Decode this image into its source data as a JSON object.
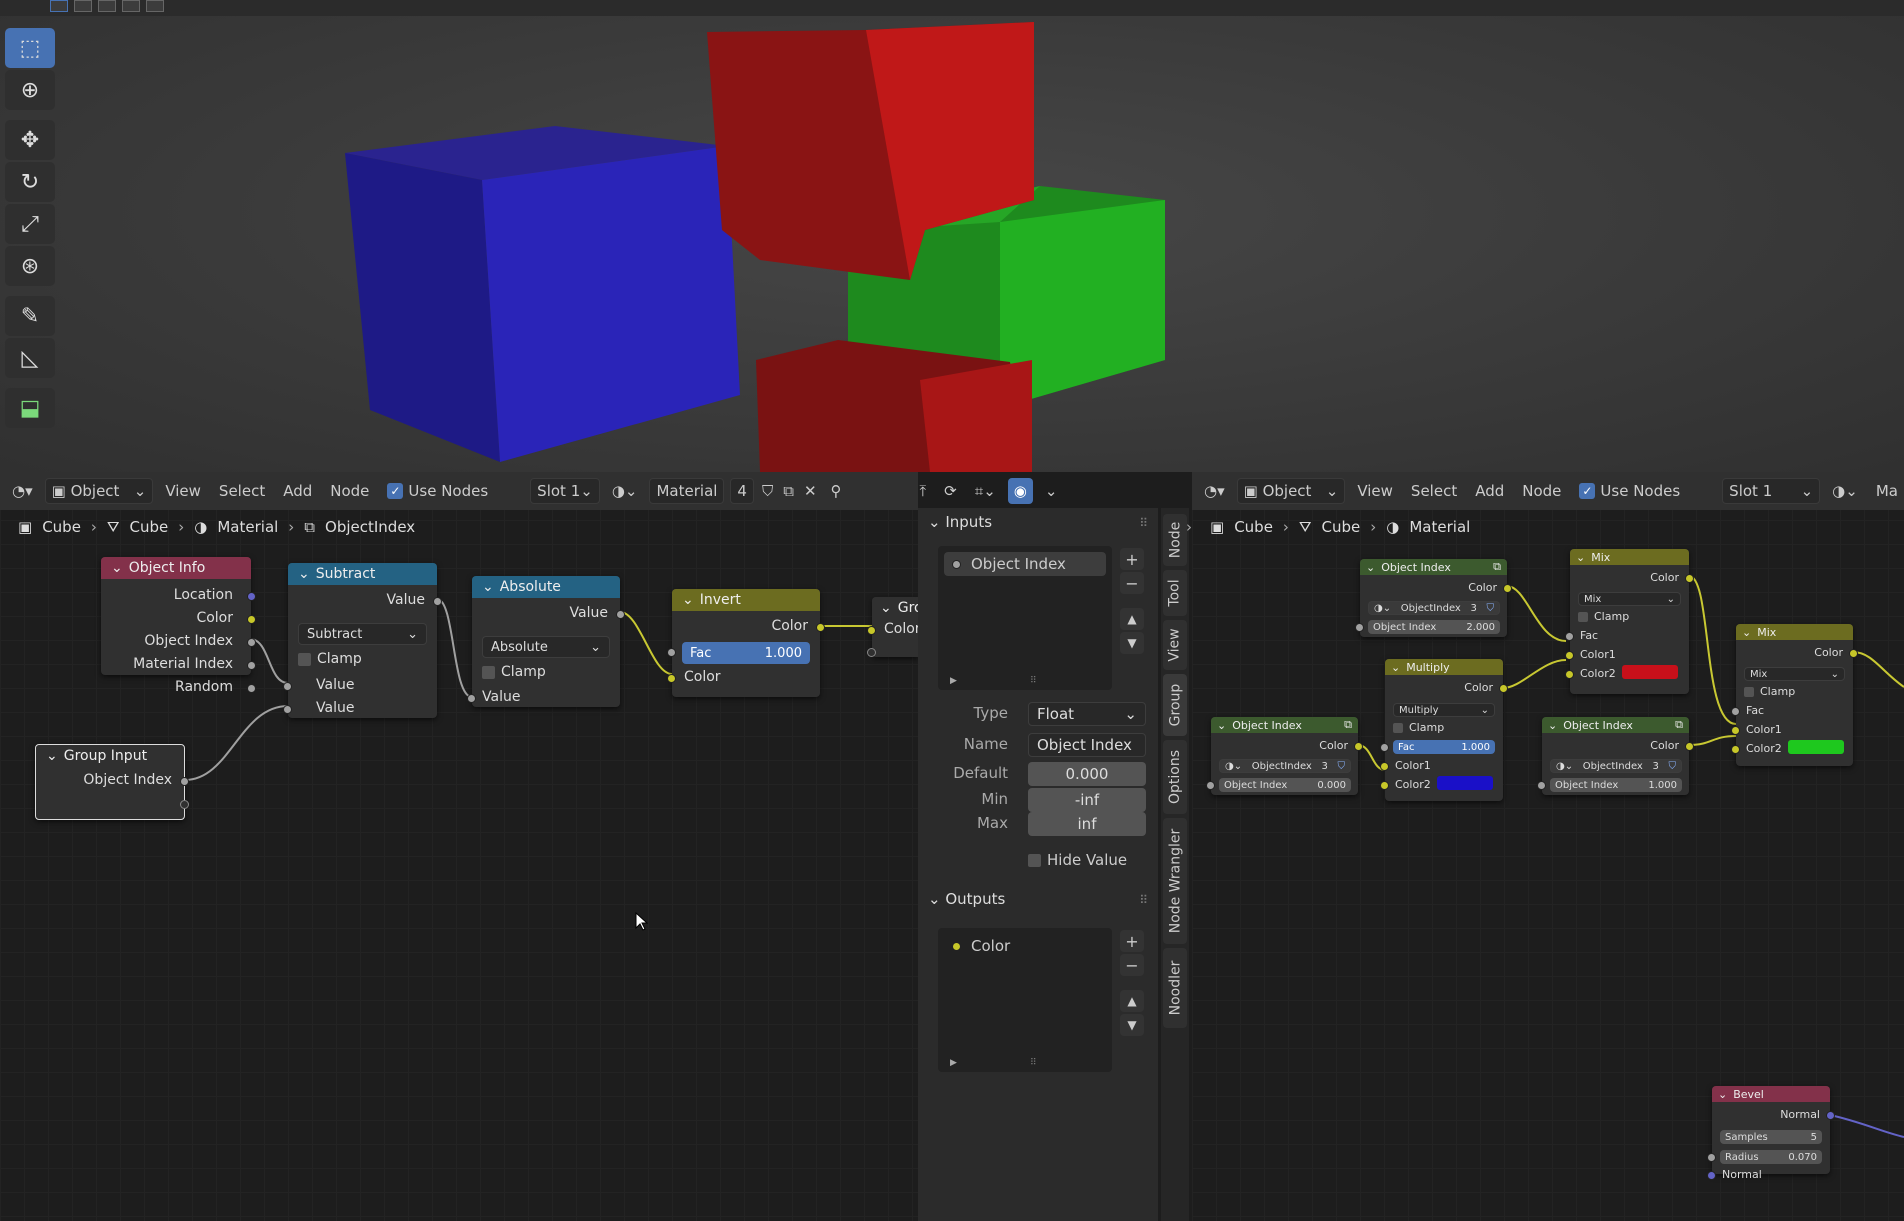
{
  "viewport": {
    "tools": [
      "select-box-icon",
      "cursor-icon",
      "move-icon",
      "rotate-icon",
      "scale-icon",
      "transform-icon",
      "annotate-icon",
      "measure-icon",
      "add-cube-icon"
    ]
  },
  "left_editor": {
    "header": {
      "editor_type": "",
      "mode": "Object",
      "view": "View",
      "select": "Select",
      "add": "Add",
      "node": "Node",
      "use_nodes": "Use Nodes",
      "slot": "Slot 1",
      "material": "Material",
      "users": "4"
    },
    "breadcrumb": [
      "Cube",
      "Cube",
      "Material",
      "ObjectIndex"
    ],
    "nodes": {
      "object_info": {
        "title": "Object Info",
        "outputs": [
          "Location",
          "Color",
          "Object Index",
          "Material Index",
          "Random"
        ]
      },
      "subtract": {
        "title": "Subtract",
        "output": "Value",
        "op": "Subtract",
        "clamp": "Clamp",
        "inputs": [
          "Value",
          "Value"
        ]
      },
      "absolute": {
        "title": "Absolute",
        "output": "Value",
        "op": "Absolute",
        "clamp": "Clamp",
        "input": "Value"
      },
      "invert": {
        "title": "Invert",
        "output": "Color",
        "fac_label": "Fac",
        "fac_value": "1.000",
        "input": "Color"
      },
      "group_output": {
        "title": "Gro",
        "input": "Color"
      },
      "group_input": {
        "title": "Group Input",
        "output": "Object Index"
      }
    }
  },
  "side_panel": {
    "inputs_title": "Inputs",
    "input_item": "Object Index",
    "type_label": "Type",
    "type_value": "Float",
    "name_label": "Name",
    "name_value": "Object Index",
    "default_label": "Default",
    "default_value": "0.000",
    "min_label": "Min",
    "min_value": "-inf",
    "max_label": "Max",
    "max_value": "inf",
    "hide_value": "Hide Value",
    "outputs_title": "Outputs",
    "output_item": "Color",
    "tabs": [
      "Node",
      "Tool",
      "View",
      "Group",
      "Options",
      "Node Wrangler",
      "Noodler"
    ]
  },
  "right_editor": {
    "header": {
      "mode": "Object",
      "view": "View",
      "select": "Select",
      "add": "Add",
      "node": "Node",
      "use_nodes": "Use Nodes",
      "slot": "Slot 1",
      "material": "Ma"
    },
    "breadcrumb": [
      "Cube",
      "Cube",
      "Material"
    ],
    "nodes": {
      "oi1": {
        "title": "Object Index",
        "output": "Color",
        "group": "ObjectIndex",
        "users": "3",
        "input_label": "Object Index",
        "input_value": "2.000"
      },
      "oi2": {
        "title": "Object Index",
        "output": "Color",
        "group": "ObjectIndex",
        "users": "3",
        "input_label": "Object Index",
        "input_value": "0.000"
      },
      "oi3": {
        "title": "Object Index",
        "output": "Color",
        "group": "ObjectIndex",
        "users": "3",
        "input_label": "Object Index",
        "input_value": "1.000"
      },
      "multiply": {
        "title": "Multiply",
        "output": "Color",
        "op": "Multiply",
        "clamp": "Clamp",
        "fac_label": "Fac",
        "fac_value": "1.000",
        "c1": "Color1",
        "c2": "Color2",
        "color2": "#1a10c8"
      },
      "mix1": {
        "title": "Mix",
        "output": "Color",
        "op": "Mix",
        "clamp": "Clamp",
        "fac": "Fac",
        "c1": "Color1",
        "c2": "Color2",
        "color2": "#c8101a"
      },
      "mix2": {
        "title": "Mix",
        "output": "Color",
        "op": "Mix",
        "clamp": "Clamp",
        "fac": "Fac",
        "c1": "Color1",
        "c2": "Color2",
        "color2": "#1ec81e"
      },
      "bevel": {
        "title": "Bevel",
        "output": "Normal",
        "samples_label": "Samples",
        "samples_value": "5",
        "radius_label": "Radius",
        "radius_value": "0.070",
        "input": "Normal"
      }
    }
  }
}
